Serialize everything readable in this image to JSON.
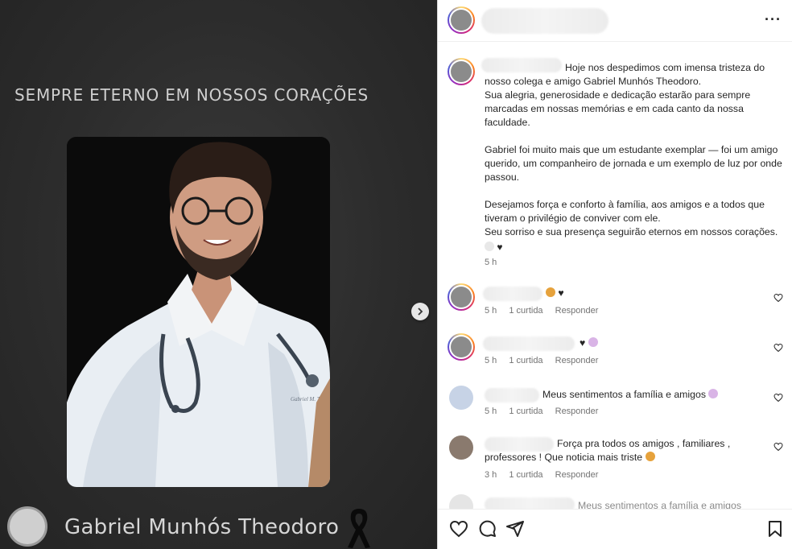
{
  "media": {
    "heading": "SEMPRE ETERNO EM NOSSOS CORAÇÕES",
    "name": "Gabriel Munhós Theodoro",
    "coat_embroidery": "Gabriel M. T."
  },
  "caption": {
    "para1": "Hoje nos despedimos com imensa tristeza do nosso colega e amigo Gabriel Munhós Theodoro.",
    "para1b": "Sua alegria, generosidade e dedicação estarão para sempre marcadas em nossas memórias e em cada canto da nossa faculdade.",
    "para2": "Gabriel foi muito mais que um estudante exemplar — foi um amigo querido, um companheiro de jornada e um exemplo de luz por onde passou.",
    "para3": "Desejamos força e conforto à família, aos amigos e a todos que tiveram o privilégio de conviver com ele.",
    "para3b": "Seu sorriso e sua presença seguirão eternos em nossos corações.",
    "time": "5 h"
  },
  "comments": [
    {
      "text": "",
      "time": "5 h",
      "likes": "1 curtida",
      "reply": "Responder",
      "emojis": [
        "sad-face-emoji",
        "black-heart-emoji"
      ]
    },
    {
      "text": "",
      "time": "5 h",
      "likes": "1 curtida",
      "reply": "Responder",
      "emojis": [
        "black-heart-emoji",
        "praying-person-emoji"
      ]
    },
    {
      "text": "Meus sentimentos a família e amigos",
      "time": "5 h",
      "likes": "1 curtida",
      "reply": "Responder",
      "emojis": [
        "praying-person-emoji"
      ]
    },
    {
      "text": "Força pra todos os amigos , familiares , professores ! Que noticia mais triste",
      "time": "3 h",
      "likes": "1 curtida",
      "reply": "Responder",
      "emojis": [
        "sad-face-emoji"
      ]
    },
    {
      "text": "Meus sentimentos a família e amigos",
      "time": "",
      "likes": "",
      "reply": "",
      "emojis": []
    }
  ],
  "icons": {
    "more": "more-options-icon",
    "like": "heart-icon",
    "comment": "comment-icon",
    "share": "share-icon",
    "save": "bookmark-icon",
    "next": "chevron-right-icon"
  },
  "colors": {
    "story_ring": "#d62976",
    "text": "#262626",
    "muted": "#737373",
    "media_bg": "#2c2c2c"
  }
}
